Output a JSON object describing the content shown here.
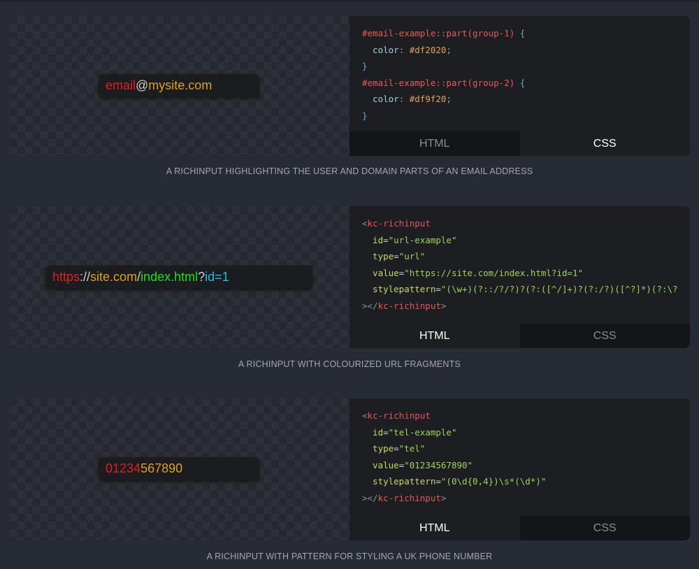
{
  "demos": [
    {
      "input_segments": [
        {
          "text": "email",
          "color": "#df2020"
        },
        {
          "text": "@",
          "color": "#cfcfcf"
        },
        {
          "text": "mysite.com",
          "color": "#df9f20"
        }
      ],
      "code_lines": [
        [
          {
            "t": "#email-example::part(group-1)",
            "c": "c-sel"
          },
          {
            "t": " {",
            "c": "c-brace"
          }
        ],
        [
          {
            "t": "  color",
            "c": "c-prop"
          },
          {
            "t": ": ",
            "c": "c-punct"
          },
          {
            "t": "#df2020",
            "c": "c-val"
          },
          {
            "t": ";",
            "c": "c-punct"
          }
        ],
        [
          {
            "t": "}",
            "c": "c-brace"
          }
        ],
        [
          {
            "t": "#email-example::part(group-2)",
            "c": "c-sel"
          },
          {
            "t": " {",
            "c": "c-brace"
          }
        ],
        [
          {
            "t": "  color",
            "c": "c-prop"
          },
          {
            "t": ": ",
            "c": "c-punct"
          },
          {
            "t": "#df9f20",
            "c": "c-val"
          },
          {
            "t": ";",
            "c": "c-punct"
          }
        ],
        [
          {
            "t": "}",
            "c": "c-brace"
          }
        ]
      ],
      "tabs": [
        {
          "label": "HTML",
          "active": false
        },
        {
          "label": "CSS",
          "active": true
        }
      ],
      "caption": "A RICHINPUT HIGHLIGHTING THE USER AND DOMAIN PARTS OF AN EMAIL ADDRESS"
    },
    {
      "input_segments": [
        {
          "text": "https",
          "color": "#df2020"
        },
        {
          "text": "://",
          "color": "#cfcfcf"
        },
        {
          "text": "site.com",
          "color": "#df9f20"
        },
        {
          "text": "/",
          "color": "#cfcfcf"
        },
        {
          "text": "index.html",
          "color": "#20df20"
        },
        {
          "text": "?",
          "color": "#cfcfcf"
        },
        {
          "text": "id=1",
          "color": "#20c0df"
        }
      ],
      "code_lines": [
        [
          {
            "t": "<",
            "c": "c-lt"
          },
          {
            "t": "kc-richinput",
            "c": "c-tag"
          }
        ],
        [
          {
            "t": "  id",
            "c": "c-attr"
          },
          {
            "t": "=",
            "c": "c-eq"
          },
          {
            "t": "\"url-example\"",
            "c": "c-str"
          }
        ],
        [
          {
            "t": "  type",
            "c": "c-attr"
          },
          {
            "t": "=",
            "c": "c-eq"
          },
          {
            "t": "\"url\"",
            "c": "c-str"
          }
        ],
        [
          {
            "t": "  value",
            "c": "c-attr"
          },
          {
            "t": "=",
            "c": "c-eq"
          },
          {
            "t": "\"https://site.com/index.html?id=1\"",
            "c": "c-str"
          }
        ],
        [
          {
            "t": "  stylepattern",
            "c": "c-attr"
          },
          {
            "t": "=",
            "c": "c-eq"
          },
          {
            "t": "\"(\\w+)(?::/?/?)?(?:([^/]+)?(?:/?)([^?]*)(?:\\?",
            "c": "c-str"
          }
        ],
        [
          {
            "t": "></",
            "c": "c-lt"
          },
          {
            "t": "kc-richinput",
            "c": "c-tag"
          },
          {
            "t": ">",
            "c": "c-lt"
          }
        ]
      ],
      "tabs": [
        {
          "label": "HTML",
          "active": true
        },
        {
          "label": "CSS",
          "active": false
        }
      ],
      "caption": "A RICHINPUT WITH COLOURIZED URL FRAGMENTS"
    },
    {
      "input_segments": [
        {
          "text": "01234",
          "color": "#df2020"
        },
        {
          "text": "567890",
          "color": "#df9f20"
        }
      ],
      "code_lines": [
        [
          {
            "t": "<",
            "c": "c-lt"
          },
          {
            "t": "kc-richinput",
            "c": "c-tag"
          }
        ],
        [
          {
            "t": "  id",
            "c": "c-attr"
          },
          {
            "t": "=",
            "c": "c-eq"
          },
          {
            "t": "\"tel-example\"",
            "c": "c-str"
          }
        ],
        [
          {
            "t": "  type",
            "c": "c-attr"
          },
          {
            "t": "=",
            "c": "c-eq"
          },
          {
            "t": "\"tel\"",
            "c": "c-str"
          }
        ],
        [
          {
            "t": "  value",
            "c": "c-attr"
          },
          {
            "t": "=",
            "c": "c-eq"
          },
          {
            "t": "\"01234567890\"",
            "c": "c-str"
          }
        ],
        [
          {
            "t": "  stylepattern",
            "c": "c-attr"
          },
          {
            "t": "=",
            "c": "c-eq"
          },
          {
            "t": "\"(0\\d{0,4})\\s*(\\d*)\"",
            "c": "c-str"
          }
        ],
        [
          {
            "t": "></",
            "c": "c-lt"
          },
          {
            "t": "kc-richinput",
            "c": "c-tag"
          },
          {
            "t": ">",
            "c": "c-lt"
          }
        ]
      ],
      "tabs": [
        {
          "label": "HTML",
          "active": true
        },
        {
          "label": "CSS",
          "active": false
        }
      ],
      "caption": "A RICHINPUT WITH PATTERN FOR STYLING A UK PHONE NUMBER"
    }
  ]
}
